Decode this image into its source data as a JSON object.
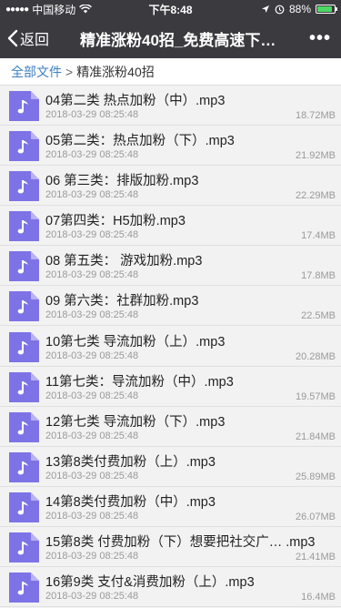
{
  "status_bar": {
    "carrier": "中国移动",
    "time": "下午8:48",
    "battery": "88%",
    "battery_level": 0.88
  },
  "navbar": {
    "back_label": "返回",
    "title": "精准涨粉40招_免费高速下…",
    "more_label": "•••"
  },
  "breadcrumb": {
    "root": "全部文件",
    "separator": ">",
    "current": "精准涨粉40招"
  },
  "files": [
    {
      "name": "04第二类 热点加粉（中）.mp3",
      "date": "2018-03-29 08:25:48",
      "size": "18.72MB"
    },
    {
      "name": "05第二类：热点加粉（下）.mp3",
      "date": "2018-03-29 08:25:48",
      "size": "21.92MB"
    },
    {
      "name": "06 第三类：排版加粉.mp3",
      "date": "2018-03-29 08:25:48",
      "size": "22.29MB"
    },
    {
      "name": "07第四类：H5加粉.mp3",
      "date": "2018-03-29 08:25:48",
      "size": "17.4MB"
    },
    {
      "name": "08 第五类： 游戏加粉.mp3",
      "date": "2018-03-29 08:25:48",
      "size": "17.8MB"
    },
    {
      "name": "09 第六类：社群加粉.mp3",
      "date": "2018-03-29 08:25:48",
      "size": "22.5MB"
    },
    {
      "name": "10第七类 导流加粉（上）.mp3",
      "date": "2018-03-29 08:25:48",
      "size": "20.28MB"
    },
    {
      "name": "11第七类：导流加粉（中）.mp3",
      "date": "2018-03-29 08:25:48",
      "size": "19.57MB"
    },
    {
      "name": "12第七类 导流加粉（下）.mp3",
      "date": "2018-03-29 08:25:48",
      "size": "21.84MB"
    },
    {
      "name": "13第8类付费加粉（上）.mp3",
      "date": "2018-03-29 08:25:48",
      "size": "25.89MB"
    },
    {
      "name": "14第8类付费加粉（中）.mp3",
      "date": "2018-03-29 08:25:48",
      "size": "26.07MB"
    },
    {
      "name": "15第8类 付费加粉（下）想要把社交广… .mp3",
      "date": "2018-03-29 08:25:48",
      "size": "21.41MB"
    },
    {
      "name": "16第9类 支付&消费加粉（上）.mp3",
      "date": "2018-03-29 08:25:48",
      "size": "16.4MB"
    }
  ],
  "colors": {
    "navbar_bg": "#3a3a3f",
    "link": "#3c7fbf",
    "file_icon": "#7d73e6"
  },
  "icons": {
    "file": "music-file-icon",
    "back": "chevron-left-icon",
    "more": "more-dots-icon"
  }
}
